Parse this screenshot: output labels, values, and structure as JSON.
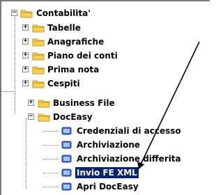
{
  "tree_top": {
    "root": {
      "label": "Contabilita'",
      "expanded": true,
      "toggle": "−"
    },
    "children": [
      {
        "label": "Tabelle",
        "toggle": "+"
      },
      {
        "label": "Anagrafiche",
        "toggle": "+"
      },
      {
        "label": "Piano dei conti",
        "toggle": "+"
      },
      {
        "label": "Prima nota",
        "toggle": "+"
      },
      {
        "label": "Cespiti",
        "toggle": "+"
      }
    ]
  },
  "tree_bottom": {
    "business_file": {
      "label": "Business File",
      "toggle": "+"
    },
    "doceasy": {
      "label": "DocEasy",
      "toggle": "−"
    },
    "doceasy_children": [
      {
        "label": "Credenziali di accesso"
      },
      {
        "label": "Archiviazione"
      },
      {
        "label": "Archiviazione differita"
      },
      {
        "label": "Invio FE XML",
        "selected": true
      },
      {
        "label": "Apri DocEasy"
      }
    ]
  },
  "colors": {
    "folder": "#f5cf54",
    "folder_dark": "#c79a17",
    "selection": "#0a246a",
    "doc_icon": "#3c6fd6"
  },
  "icons": [
    "folder-icon",
    "document-icon",
    "arrow-annotation"
  ]
}
